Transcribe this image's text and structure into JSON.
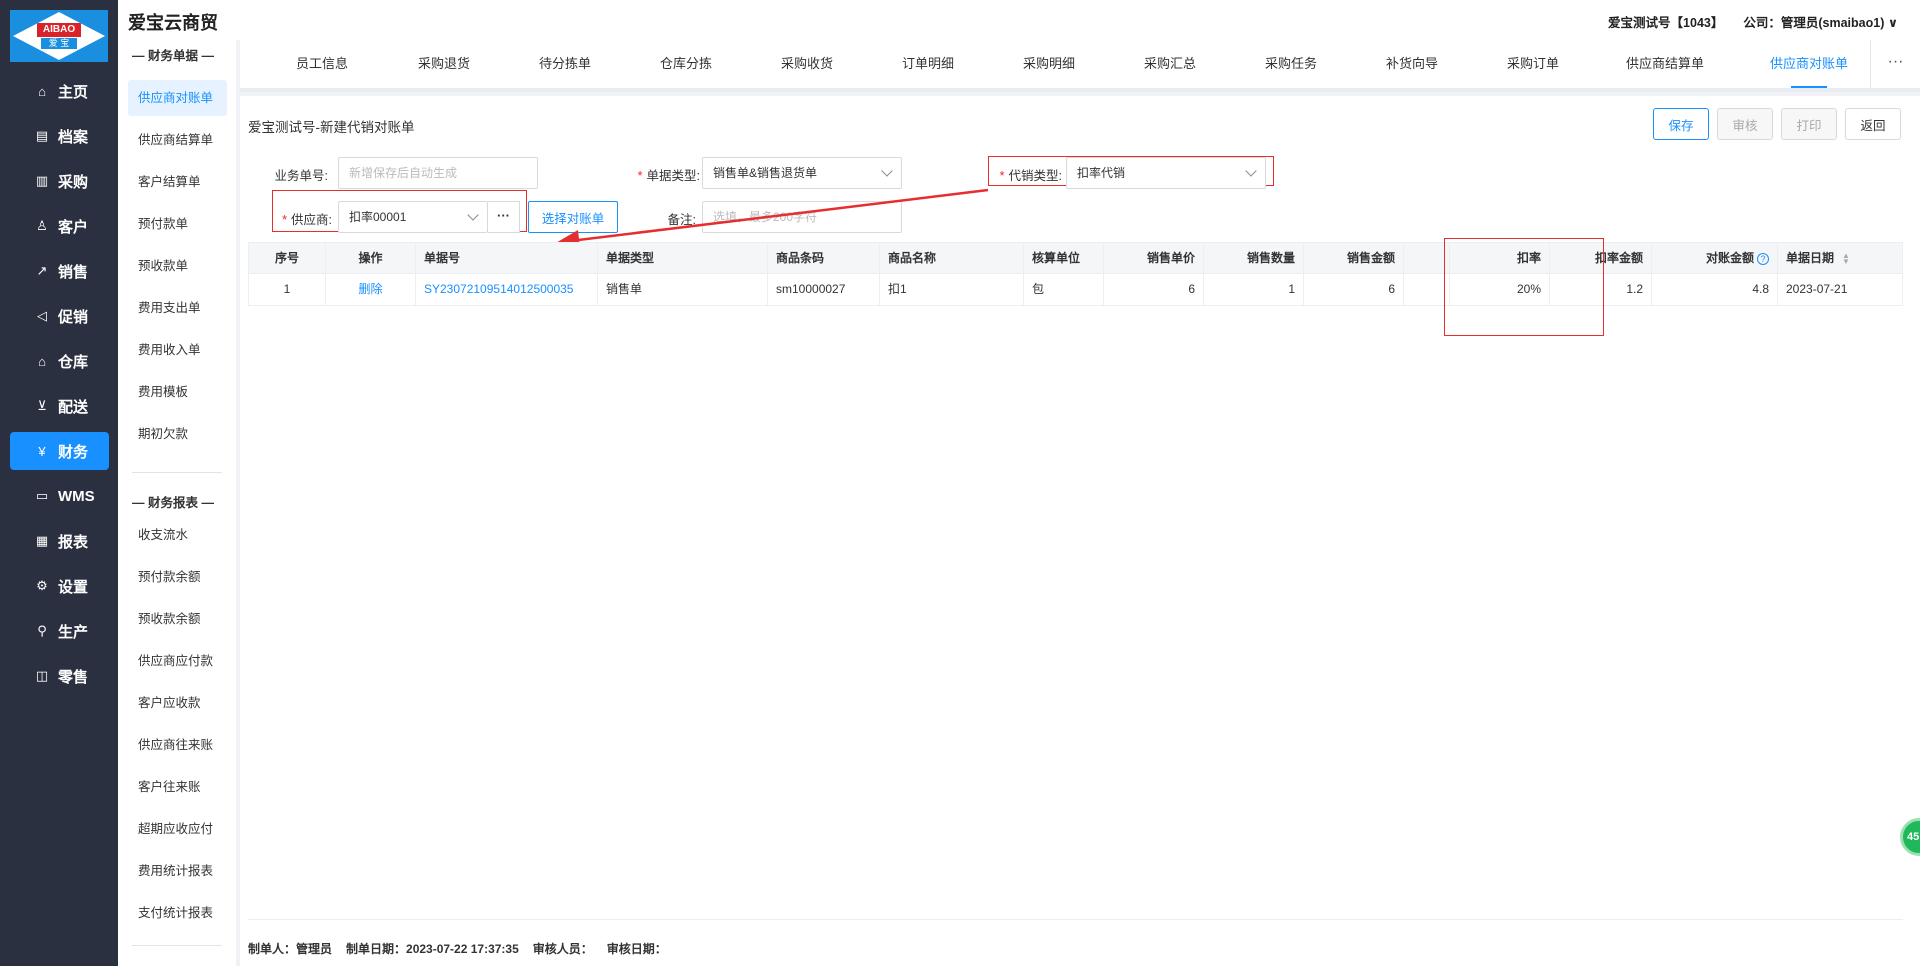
{
  "app": {
    "logo_brand": "AIBAO",
    "logo_sub": "爱 宝",
    "title": "爱宝云商贸",
    "account": "爱宝测试号【1043】",
    "company": "公司：管理员(smaibao1)"
  },
  "nav": [
    {
      "label": "主页",
      "icon": "home-icon",
      "glyph": "⌂"
    },
    {
      "label": "档案",
      "icon": "archive-icon",
      "glyph": "▤"
    },
    {
      "label": "采购",
      "icon": "purchase-icon",
      "glyph": "▥"
    },
    {
      "label": "客户",
      "icon": "customer-icon",
      "glyph": "♙"
    },
    {
      "label": "销售",
      "icon": "sales-chart-icon",
      "glyph": "↗"
    },
    {
      "label": "促销",
      "icon": "megaphone-icon",
      "glyph": "◁"
    },
    {
      "label": "仓库",
      "icon": "warehouse-icon",
      "glyph": "⌂"
    },
    {
      "label": "配送",
      "icon": "cart-icon",
      "glyph": "⊻"
    },
    {
      "label": "财务",
      "icon": "finance-icon",
      "glyph": "¥"
    },
    {
      "label": "WMS",
      "icon": "truck-icon",
      "glyph": "▭"
    },
    {
      "label": "报表",
      "icon": "report-icon",
      "glyph": "▦"
    },
    {
      "label": "设置",
      "icon": "gear-icon",
      "glyph": "⚙"
    },
    {
      "label": "生产",
      "icon": "production-icon",
      "glyph": "⚲"
    },
    {
      "label": "零售",
      "icon": "retail-bag-icon",
      "glyph": "◫"
    }
  ],
  "sidebar": {
    "group1": "— 财务单据 —",
    "items1": [
      "供应商对账单",
      "供应商结算单",
      "客户结算单",
      "预付款单",
      "预收款单",
      "费用支出单",
      "费用收入单",
      "费用模板",
      "期初欠款"
    ],
    "group2": "— 财务报表 —",
    "items2": [
      "收支流水",
      "预付款余额",
      "预收款余额",
      "供应商应付款",
      "客户应收款",
      "供应商往来账",
      "客户往来账",
      "超期应收应付",
      "费用统计报表",
      "支付统计报表"
    ]
  },
  "tabs": [
    "员工信息",
    "采购退货",
    "待分拣单",
    "仓库分拣",
    "采购收货",
    "订单明细",
    "采购明细",
    "采购汇总",
    "采购任务",
    "补货向导",
    "采购订单",
    "供应商结算单",
    "供应商对账单"
  ],
  "tab_more": "···",
  "doc": {
    "title": "爱宝测试号-新建代销对账单",
    "buttons": {
      "save": "保存",
      "audit": "审核",
      "print": "打印",
      "back": "返回"
    }
  },
  "form": {
    "bizno_label": "业务单号:",
    "bizno_placeholder": "新增保存后自动生成",
    "doctype_label": "单据类型:",
    "doctype_value": "销售单&销售退货单",
    "consign_label": "代销类型:",
    "consign_value": "扣率代销",
    "supplier_label": "供应商:",
    "supplier_value": "扣率00001",
    "dots": "···",
    "select_btn": "选择对账单",
    "remark_label": "备注:",
    "remark_placeholder": "选填，最多200字符"
  },
  "table": {
    "headers": [
      "序号",
      "操作",
      "单据号",
      "单据类型",
      "商品条码",
      "商品名称",
      "核算单位",
      "销售单价",
      "销售数量",
      "销售金额",
      "",
      "扣率",
      "扣率金额",
      "对账金额",
      "单据日期"
    ],
    "rows": [
      [
        "1",
        "删除",
        "SY23072109514012500035",
        "销售单",
        "sm10000027",
        "扣1",
        "包",
        "6",
        "1",
        "6",
        "",
        "20%",
        "1.2",
        "4.8",
        "2023-07-21"
      ]
    ]
  },
  "footer": {
    "maker": "制单人：管理员",
    "date": "制单日期：2023-07-22 17:37:35",
    "auditor": "审核人员：",
    "audit_date": "审核日期："
  },
  "float_badge": "45"
}
